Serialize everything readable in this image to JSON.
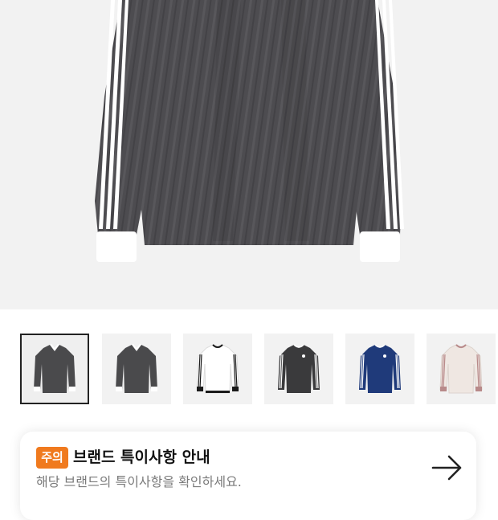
{
  "product_image": {
    "alt_icon": "shirt-image"
  },
  "thumbnails": [
    {
      "color": "#4a4a4c",
      "trim": "#ffffff",
      "collar": "v-neck",
      "selected": true
    },
    {
      "color": "#4a4a4c",
      "trim": "#ffffff",
      "collar": "v-neck",
      "selected": false
    },
    {
      "color": "#ffffff",
      "trim": "#1a1a1a",
      "collar": "crew",
      "selected": false
    },
    {
      "color": "#3a3a3c",
      "trim": "#ffffff",
      "collar": "crew",
      "selected": false
    },
    {
      "color": "#1f3a7a",
      "trim": "#ffffff",
      "collar": "crew",
      "selected": false
    },
    {
      "color": "#efe7e2",
      "trim": "#b88a8a",
      "collar": "crew",
      "selected": false
    }
  ],
  "notice": {
    "badge": "주의",
    "badge_color": "#f07a1e",
    "title": "브랜드 특이사항 안내",
    "description": "해당 브랜드의 특이사항을 확인하세요.",
    "arrow_icon": "arrow-right-icon"
  }
}
